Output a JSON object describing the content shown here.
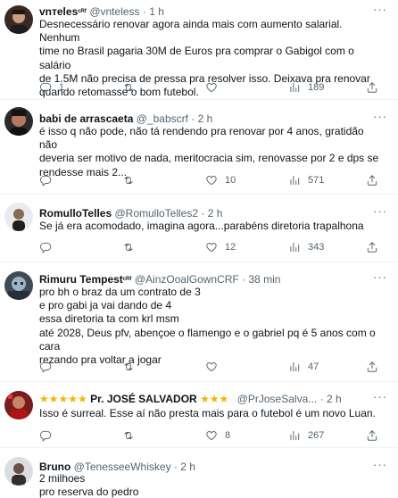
{
  "tweets": [
    {
      "name": "vnтeles",
      "badge": "ᶜᴿᶠ",
      "handle": "@vnteless",
      "time": "1 h",
      "text": "Desnecessário renovar agora ainda mais com aumento salarial. Nenhum\ntime no Brasil pagaria 30M de Euros pra comprar o Gabigol com o salário\nde 1.5M não precisa de pressa pra resolver isso. Deixava pra renovar\nquando retomasse o bom futebol.",
      "replies": "1",
      "retweets": "",
      "likes": "",
      "views": "189"
    },
    {
      "name": "babi de arrascaeta",
      "handle": "@_babscrf",
      "time": "2 h",
      "text": "é isso q não pode, não tá rendendo pra renovar por 4 anos, gratidão não\ndeveria ser motivo de nada, meritocracia sim, renovasse por 2 e dps se\nrendesse mais 2...",
      "replies": "",
      "retweets": "",
      "likes": "10",
      "views": "571"
    },
    {
      "name": "RomulloTelles",
      "handle": "@RomulloTelles2",
      "time": "2 h",
      "text": "Se já era acomodado, imagina agora...parabéns diretoria trapalhona",
      "replies": "",
      "retweets": "",
      "likes": "12",
      "views": "343"
    },
    {
      "name": "Rimuru Tempest",
      "badge": "ᶜᴿᶠ",
      "handle": "@AinzOoalGownCRF",
      "time": "38 min",
      "text": "pro bh o braz da um contrato de 3\ne pro gabi ja vai dando de 4\nessa diretoria ta com krl msm\naté 2028, Deus pfv, abençoe o flamengo e o gabriel pq é 5 anos com o cara\nrezando pra voltar a jogar",
      "replies": "",
      "retweets": "",
      "likes": "",
      "views": "47"
    },
    {
      "stars_left": "★★★★★",
      "name": "Pr. JOSÉ SALVADOR",
      "stars_right": "★★★",
      "handle": "@PrJoseSalva...",
      "time": "2 h",
      "text": "Isso é surreal. Esse aí não presta mais para o futebol é um novo Luan.",
      "replies": "",
      "retweets": "",
      "likes": "8",
      "views": "267"
    },
    {
      "name": "Bruno",
      "handle": "@TenesseeWhiskey",
      "time": "2 h",
      "text": "2 milhoes\npro reserva do pedro",
      "replies": "",
      "retweets": "",
      "likes": "",
      "views": ""
    }
  ],
  "colors": {
    "text": "#0f1419",
    "secondary": "#536471",
    "divider": "#eff3f4",
    "star": "#f5b400"
  },
  "icons": [
    "reply-icon",
    "retweet-icon",
    "like-icon",
    "views-icon",
    "share-icon",
    "more-icon"
  ]
}
